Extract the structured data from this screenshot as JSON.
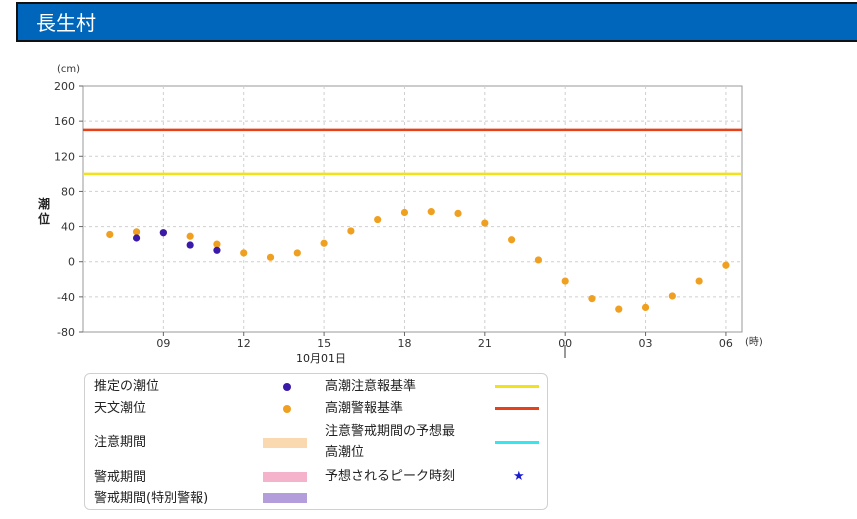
{
  "page": {
    "title": "長生村"
  },
  "colors": {
    "header_bg": "#0066bb",
    "estimated": "#3a1aa8",
    "astronomical": "#f0a020",
    "advisory": "#f2e21d",
    "warning": "#e64119",
    "caution_period": "#fbd9b0",
    "warning_period": "#f4b2cb",
    "special_warning_period": "#b39ddb",
    "forecast_max": "#34e6ef",
    "peak_star": "#1a1ad0"
  },
  "chart_data": {
    "type": "scatter",
    "ylabel": "潮位",
    "yunit": "(cm)",
    "xunit": "(時)",
    "ylim": [
      -80,
      200
    ],
    "yticks": [
      -80,
      -40,
      0,
      40,
      80,
      120,
      160,
      200
    ],
    "xlim_hours": [
      6,
      30.6
    ],
    "xticks": [
      {
        "hour": 9,
        "label": "09"
      },
      {
        "hour": 12,
        "label": "12"
      },
      {
        "hour": 15,
        "label": "15"
      },
      {
        "hour": 18,
        "label": "18"
      },
      {
        "hour": 21,
        "label": "21"
      },
      {
        "hour": 24,
        "label": "00"
      },
      {
        "hour": 27,
        "label": "03"
      },
      {
        "hour": 30,
        "label": "06"
      }
    ],
    "date_label": "10月01日",
    "grid": true,
    "series": [
      {
        "name": "天文潮位",
        "hours": [
          7,
          8,
          9,
          10,
          11,
          12,
          13,
          14,
          15,
          16,
          17,
          18,
          19,
          20,
          21,
          22,
          23,
          24,
          25,
          26,
          27,
          28,
          29,
          30
        ],
        "values": [
          31,
          34,
          33,
          29,
          20,
          10,
          5,
          10,
          21,
          35,
          48,
          56,
          57,
          55,
          44,
          25,
          2,
          -22,
          -42,
          -54,
          -52,
          -39,
          -22,
          -4
        ]
      },
      {
        "name": "推定の潮位",
        "hours": [
          8,
          9,
          10,
          11
        ],
        "values": [
          27,
          33,
          19,
          13
        ]
      }
    ],
    "thresholds": [
      {
        "name": "高潮注意報基準",
        "value": 100
      },
      {
        "name": "高潮警報基準",
        "value": 150
      }
    ]
  },
  "legend": {
    "estimated": "推定の潮位",
    "astronomical": "天文潮位",
    "caution_period": "注意期間",
    "warning_period": "警戒期間",
    "special_warning_period": "警戒期間(特別警報)",
    "advisory": "高潮注意報基準",
    "warning": "高潮警報基準",
    "forecast_max_line1": "注意警戒期間の予想最",
    "forecast_max_line2": "高潮位",
    "peak_time": "予想されるピーク時刻"
  }
}
